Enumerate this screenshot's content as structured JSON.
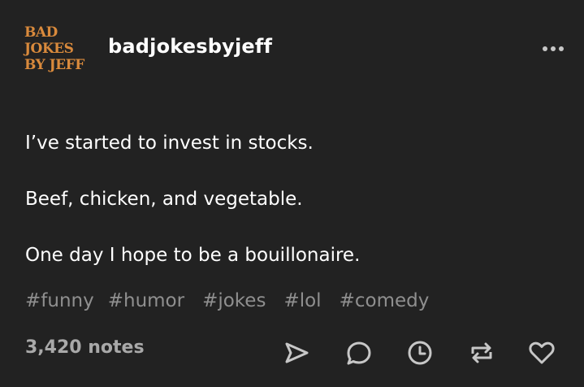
{
  "post": {
    "avatar": {
      "lines": [
        "BAD",
        "JOKES",
        "BY JEFF"
      ],
      "color": "#d98a3c"
    },
    "username": "badjokesbyjeff",
    "more_icon": "ellipsis-icon",
    "body": [
      "I’ve started to invest in stocks.",
      "Beef, chicken, and vegetable.",
      "One day I hope to be a bouillonaire."
    ],
    "tags": [
      "#funny",
      "#humor",
      "#jokes",
      "#lol",
      "#comedy"
    ],
    "notes": "3,420 notes",
    "actions": [
      {
        "name": "share",
        "icon": "send-icon"
      },
      {
        "name": "reply",
        "icon": "speech-bubble-icon"
      },
      {
        "name": "queue",
        "icon": "clock-icon"
      },
      {
        "name": "reblog",
        "icon": "reblog-icon"
      },
      {
        "name": "like",
        "icon": "heart-icon"
      }
    ],
    "colors": {
      "background": "#222222",
      "text": "#ffffff",
      "muted": "#8f8f8f",
      "icon": "#c7c7c7"
    }
  }
}
